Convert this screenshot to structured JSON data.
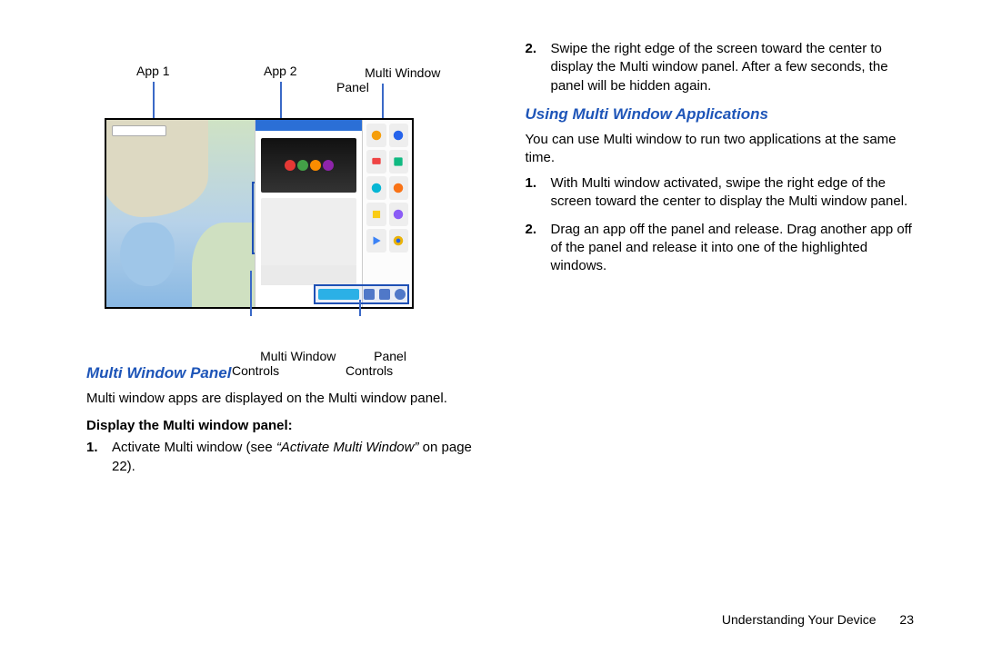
{
  "diagram": {
    "labels": {
      "app1": "App 1",
      "app2": "App 2",
      "mw_panel": "Multi Window\nPanel",
      "mw_controls": "Multi Window\nControls",
      "panel_controls": "Panel\nControls"
    }
  },
  "left": {
    "heading": "Multi Window Panel",
    "intro": "Multi window apps are displayed on the Multi window panel.",
    "subhead": "Display the Multi window panel:",
    "steps": [
      {
        "num": "1.",
        "pre": "Activate Multi window (see ",
        "ref": "“Activate Multi Window”",
        "post": " on page 22)."
      }
    ]
  },
  "right": {
    "steps_top": [
      {
        "num": "2.",
        "text": "Swipe the right edge of the screen toward the center to display the Multi window panel. After a few seconds, the panel will be hidden again."
      }
    ],
    "heading": "Using Multi Window Applications",
    "intro": "You can use Multi window to run two applications at the same time.",
    "steps": [
      {
        "num": "1.",
        "text": "With Multi window activated, swipe the right edge of the screen toward the center to display the Multi window panel."
      },
      {
        "num": "2.",
        "text": "Drag an app off the panel and release. Drag another app off of the panel and release it into one of the highlighted windows."
      }
    ]
  },
  "footer": {
    "section": "Understanding Your Device",
    "page": "23"
  }
}
